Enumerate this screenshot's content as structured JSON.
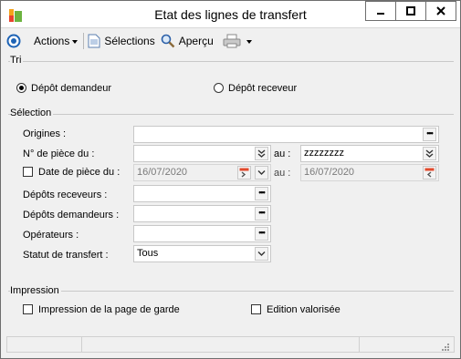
{
  "window": {
    "title": "Etat des lignes de transfert",
    "controls": {
      "minimize": "—",
      "maximize": "□",
      "close": "✕"
    }
  },
  "toolbar": {
    "actions_label": "Actions",
    "selections_label": "Sélections",
    "preview_label": "Aperçu"
  },
  "tri": {
    "group_title": "Tri",
    "radio_depot_demandeur": "Dépôt demandeur",
    "radio_depot_receveur": "Dépôt receveur",
    "selected": "depot_demandeur"
  },
  "selection": {
    "group_title": "Sélection",
    "origines_label": "Origines :",
    "origines_value": "",
    "piece_label": "N° de pièce du :",
    "piece_from_value": "",
    "piece_au_label": "au :",
    "piece_to_value": "zzzzzzzz",
    "date_label": "Date de pièce du :",
    "date_from_value": "16/07/2020",
    "date_au_label": "au :",
    "date_to_value": "16/07/2020",
    "depots_receveurs_label": "Dépôts receveurs :",
    "depots_receveurs_value": "",
    "depots_demandeurs_label": "Dépôts demandeurs :",
    "depots_demandeurs_value": "",
    "operateurs_label": "Opérateurs :",
    "operateurs_value": "",
    "statut_label": "Statut de transfert :",
    "statut_value": "Tous"
  },
  "impression": {
    "group_title": "Impression",
    "page_garde_label": "Impression de la page de garde",
    "edition_valorisee_label": "Edition valorisée"
  }
}
